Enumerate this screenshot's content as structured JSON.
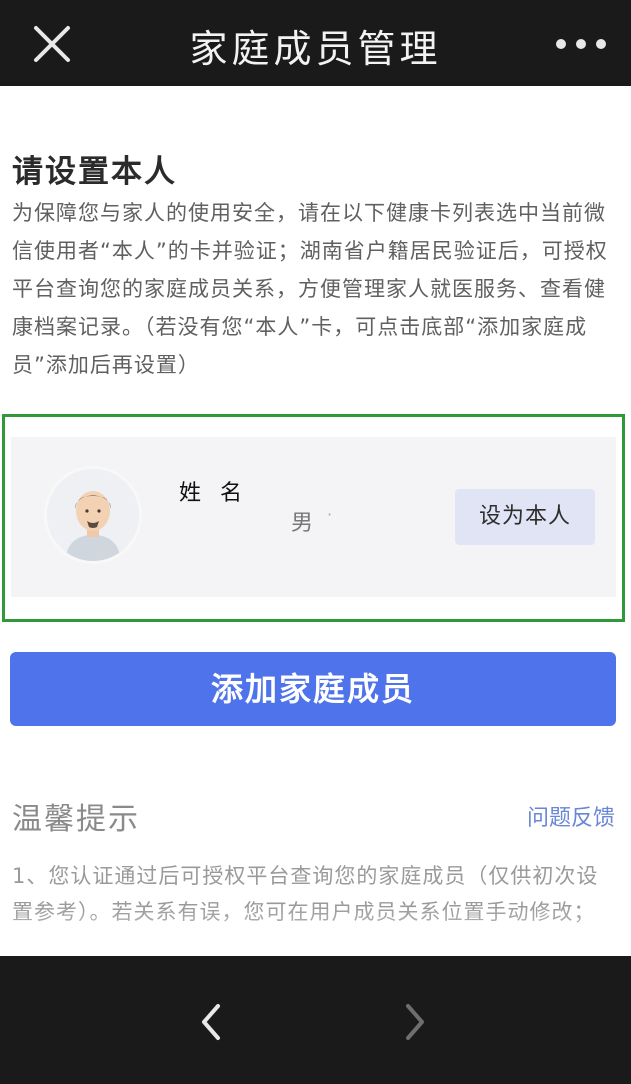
{
  "header": {
    "title": "家庭成员管理",
    "close_icon": "close-icon",
    "more_icon": "more-icon"
  },
  "main": {
    "section_title": "请设置本人",
    "description": "为保障您与家人的使用安全，请在以下健康卡列表选中当前微信使用者“本人”的卡并验证；湖南省户籍居民验证后，可授权平台查询您的家庭成员关系，方便管理家人就医服务、查看健康档案记录。（若没有您“本人”卡，可点击底部“添加家庭成员”添加后再设置）",
    "member": {
      "name": "姓 名",
      "gender": "男",
      "dot": "·",
      "set_self_label": "设为本人",
      "avatar_icon": "person-avatar-icon"
    },
    "add_member_label": "添加家庭成员",
    "tips": {
      "title": "温馨提示",
      "feedback_label": "问题反馈",
      "text": "1、您认证通过后可授权平台查询您的家庭成员（仅供初次设置参考）。若关系有误，您可在用户成员关系位置手动修改；"
    }
  },
  "bottom_nav": {
    "back_icon": "chevron-left-icon",
    "forward_icon": "chevron-right-icon"
  },
  "colors": {
    "header_bg": "#1a1a1a",
    "primary_button": "#4e73ea",
    "highlight_border": "#2f9a3a",
    "link": "#6a87d6"
  }
}
